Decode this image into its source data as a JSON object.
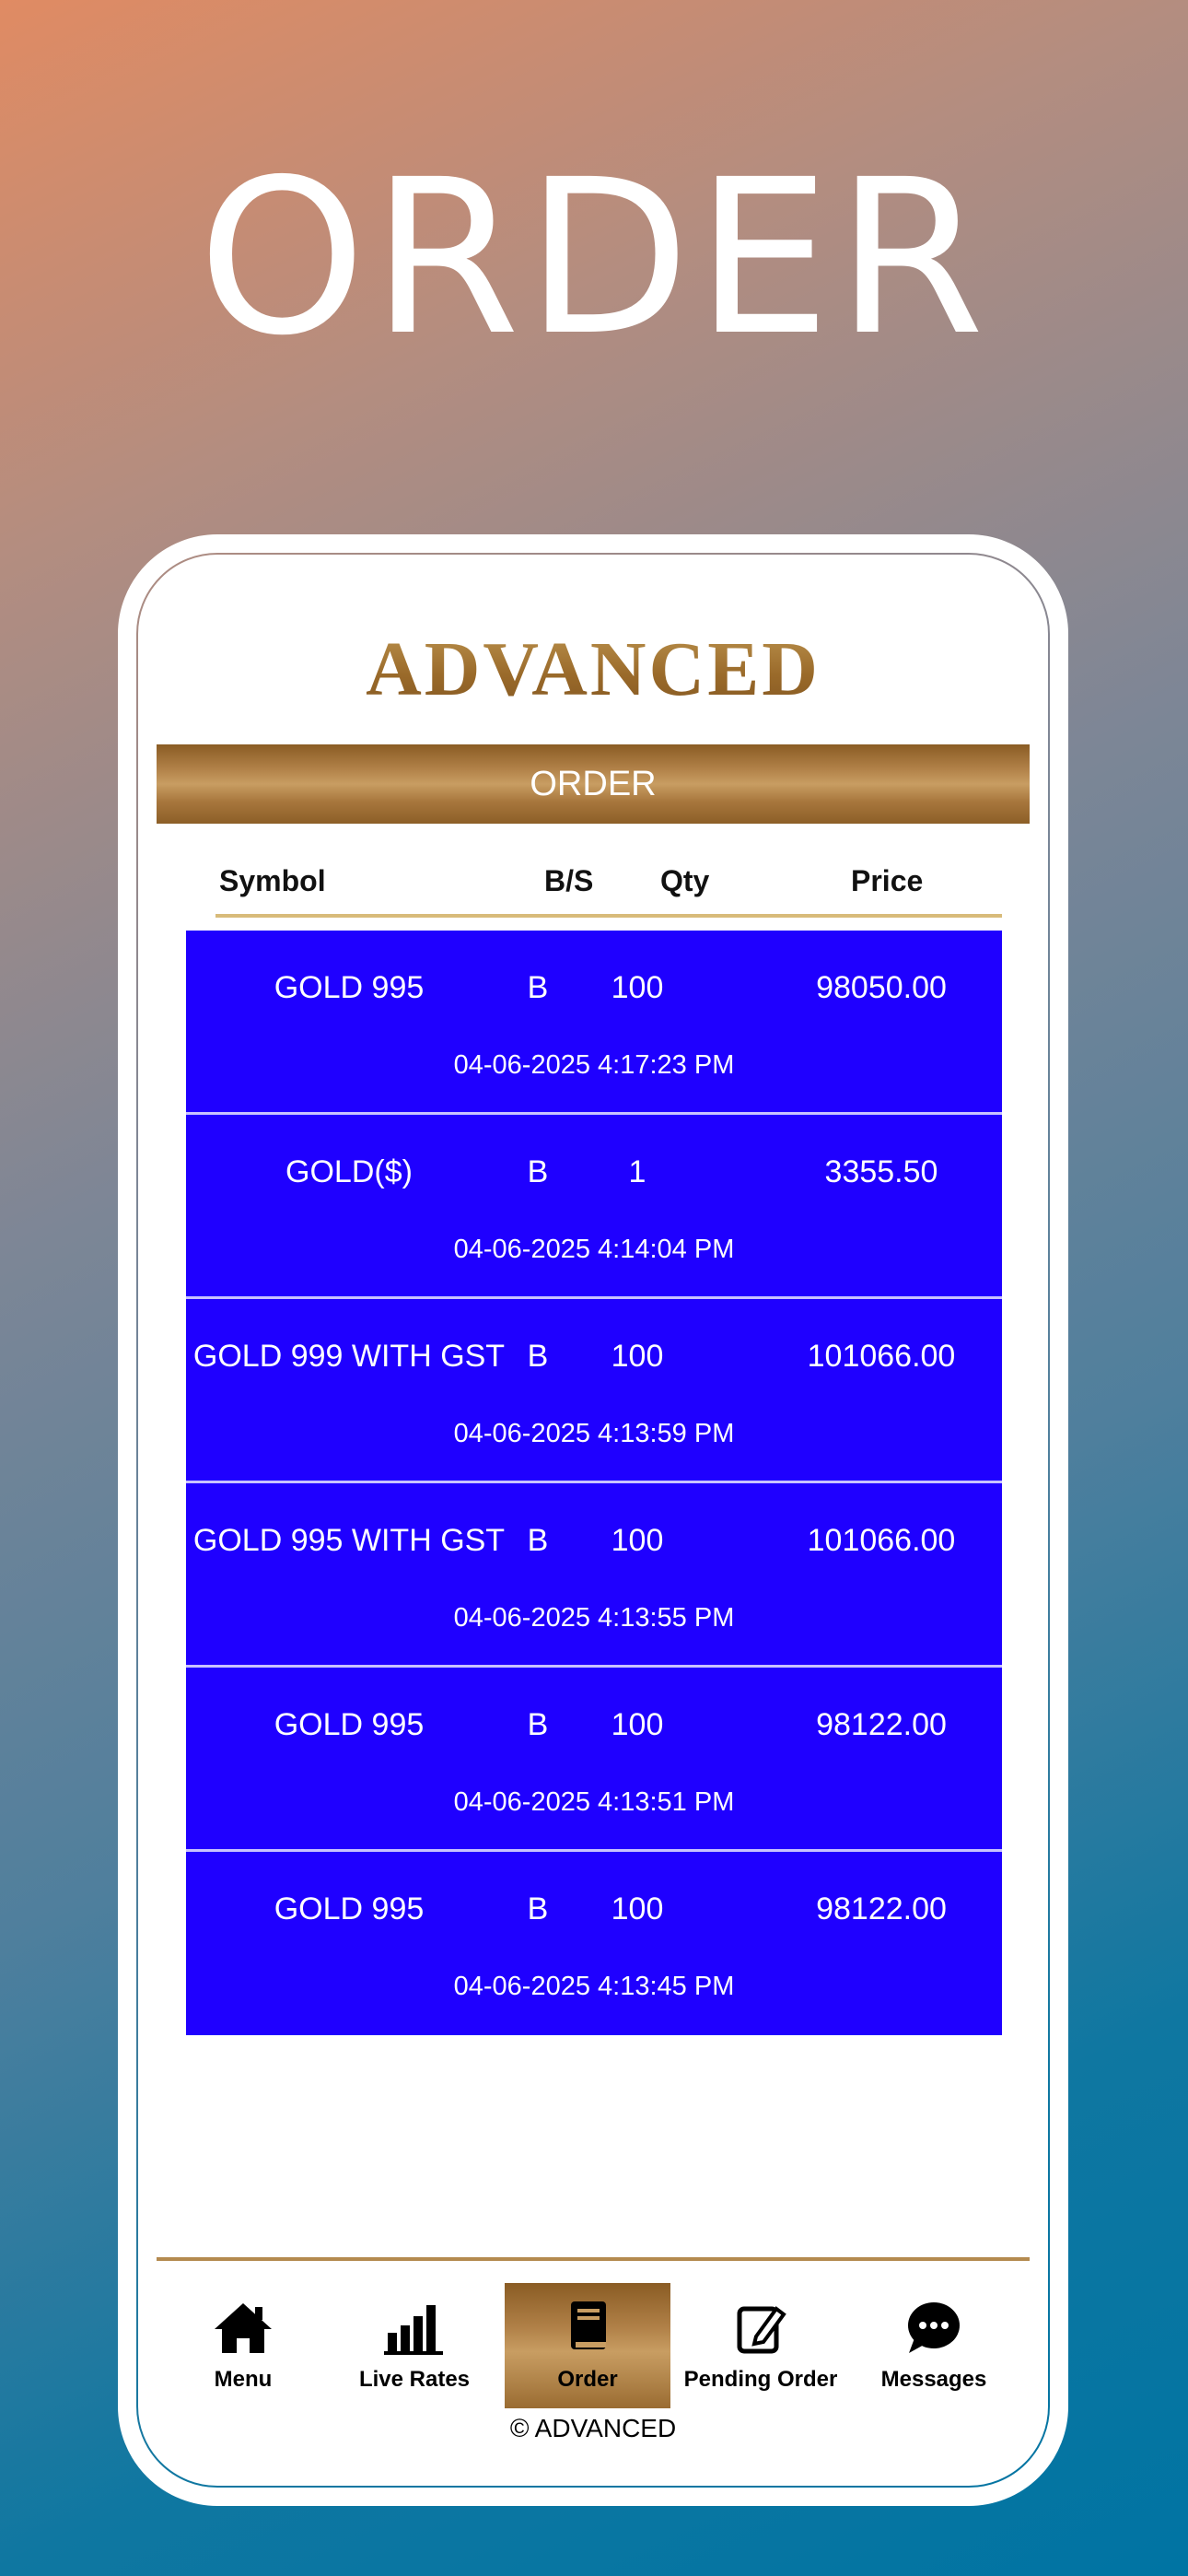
{
  "hero": {
    "title": "ORDER"
  },
  "app": {
    "brand": "ADVANCED",
    "section_title": "ORDER"
  },
  "table": {
    "headers": {
      "symbol": "Symbol",
      "bs": "B/S",
      "qty": "Qty",
      "price": "Price"
    },
    "rows": [
      {
        "symbol": "GOLD 995",
        "bs": "B",
        "qty": "100",
        "price": "98050.00",
        "datetime": "04-06-2025 4:17:23 PM"
      },
      {
        "symbol": "GOLD($)",
        "bs": "B",
        "qty": "1",
        "price": "3355.50",
        "datetime": "04-06-2025 4:14:04 PM"
      },
      {
        "symbol": "GOLD 999 WITH GST",
        "bs": "B",
        "qty": "100",
        "price": "101066.00",
        "datetime": "04-06-2025 4:13:59 PM"
      },
      {
        "symbol": "GOLD 995 WITH GST",
        "bs": "B",
        "qty": "100",
        "price": "101066.00",
        "datetime": "04-06-2025 4:13:55 PM"
      },
      {
        "symbol": "GOLD 995",
        "bs": "B",
        "qty": "100",
        "price": "98122.00",
        "datetime": "04-06-2025 4:13:51 PM"
      },
      {
        "symbol": "GOLD 995",
        "bs": "B",
        "qty": "100",
        "price": "98122.00",
        "datetime": "04-06-2025 4:13:45 PM"
      }
    ]
  },
  "nav": [
    {
      "label": "Menu",
      "icon": "home-icon",
      "active": false
    },
    {
      "label": "Live Rates",
      "icon": "bar-chart-icon",
      "active": false
    },
    {
      "label": "Order",
      "icon": "book-icon",
      "active": true
    },
    {
      "label": "Pending Order",
      "icon": "edit-icon",
      "active": false
    },
    {
      "label": "Messages",
      "icon": "chat-bubble-icon",
      "active": false
    }
  ],
  "footer": {
    "text": "© ADVANCED"
  },
  "colors": {
    "row_bg": "#1f00ff",
    "gold": "#9a6a2a",
    "accent_line": "#d8bb7a"
  }
}
